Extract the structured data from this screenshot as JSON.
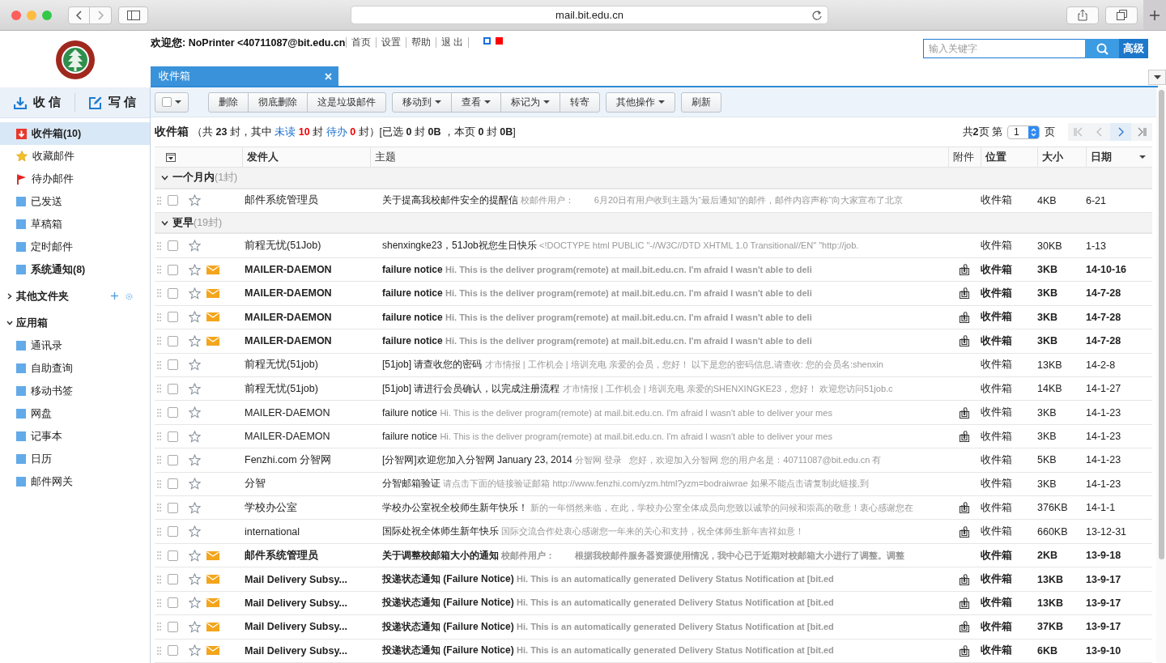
{
  "browser": {
    "url": "mail.bit.edu.cn"
  },
  "header": {
    "welcome": "欢迎您: NoPrinter <40711087@bit.edu.cn",
    "links": [
      "首页",
      "设置",
      "帮助",
      "退 出"
    ],
    "themes": [
      {
        "color": "#1a6fe0",
        "selected": true
      },
      {
        "color": "#ff0000",
        "selected": false
      }
    ],
    "search": {
      "placeholder": "输入关键字",
      "advanced": "高级"
    }
  },
  "tabs": [
    {
      "label": "收件箱",
      "selected": true
    }
  ],
  "sidebar": {
    "actions": [
      {
        "kind": "receive",
        "label": "收 信"
      },
      {
        "kind": "compose",
        "label": "写 信"
      }
    ],
    "folders": [
      {
        "kind": "inbox",
        "label": "收件箱(10)",
        "selected": true,
        "bold": true
      },
      {
        "kind": "star",
        "label": "收藏邮件",
        "selected": false,
        "bold": false
      },
      {
        "kind": "flag",
        "label": "待办邮件",
        "selected": false,
        "bold": false
      },
      {
        "kind": "folder",
        "label": "已发送",
        "selected": false,
        "bold": false
      },
      {
        "kind": "folder",
        "label": "草稿箱",
        "selected": false,
        "bold": false
      },
      {
        "kind": "folder",
        "label": "定时邮件",
        "selected": false,
        "bold": false
      },
      {
        "kind": "folder",
        "label": "系统通知(8)",
        "selected": false,
        "bold": true
      }
    ],
    "sections": [
      {
        "label": "其他文件夹",
        "expanded": false,
        "tools": true
      },
      {
        "label": "应用箱",
        "expanded": true,
        "tools": false,
        "items": [
          "通讯录",
          "自助查询",
          "移动书签",
          "网盘",
          "记事本",
          "日历",
          "邮件网关"
        ]
      }
    ]
  },
  "toolbar": {
    "groups": [
      [
        {
          "label": "删除",
          "dropdown": false
        },
        {
          "label": "彻底删除",
          "dropdown": false
        },
        {
          "label": "这是垃圾邮件",
          "dropdown": false
        }
      ],
      [
        {
          "label": "移动到",
          "dropdown": true
        },
        {
          "label": "查看",
          "dropdown": true
        },
        {
          "label": "标记为",
          "dropdown": true
        },
        {
          "label": "转寄",
          "dropdown": false
        }
      ],
      [
        {
          "label": "其他操作",
          "dropdown": true
        }
      ],
      [
        {
          "label": "刷新",
          "dropdown": false
        }
      ]
    ]
  },
  "summary": {
    "title": "收件箱",
    "parts": [
      {
        "kind": "plain",
        "text": "（共 "
      },
      {
        "kind": "bold",
        "text": "23"
      },
      {
        "kind": "plain",
        "text": " 封，其中 "
      },
      {
        "kind": "link",
        "text": "未读"
      },
      {
        "kind": "alert",
        "text": " 10"
      },
      {
        "kind": "plain",
        "text": " 封 "
      },
      {
        "kind": "link",
        "text": "待办"
      },
      {
        "kind": "alert",
        "text": " 0"
      },
      {
        "kind": "plain",
        "text": " 封）[已选 "
      },
      {
        "kind": "bold",
        "text": "0"
      },
      {
        "kind": "plain",
        "text": " 封 "
      },
      {
        "kind": "bold",
        "text": "0B"
      },
      {
        "kind": "plain",
        "text": " ，本页 "
      },
      {
        "kind": "bold",
        "text": "0"
      },
      {
        "kind": "plain",
        "text": " 封 "
      },
      {
        "kind": "bold",
        "text": "0B"
      },
      {
        "kind": "plain",
        "text": "]"
      }
    ]
  },
  "pager": {
    "total": "共**2**页 第",
    "page": "1",
    "suffix": "页",
    "buttons": [
      {
        "kind": "first",
        "disabled": true
      },
      {
        "kind": "prev",
        "disabled": true
      },
      {
        "kind": "next",
        "disabled": false
      },
      {
        "kind": "last",
        "disabled": false
      }
    ]
  },
  "table": {
    "columns": [
      "发件人",
      "主题",
      "附件",
      "位置",
      "大小",
      "日期"
    ],
    "groups": [
      {
        "label": "一个月内",
        "count": "(1封)",
        "expanded": true,
        "rows": [
          {
            "sender": "邮件系统管理员",
            "subject": "关于提高我校邮件安全的提醒信",
            "preview": "校邮件用户：        6月20日有用户收到主题为“最后通知”的邮件，邮件内容声称“向大家宣布了北京",
            "attachment": false,
            "unread": false,
            "starred": false,
            "checked": false,
            "folder": "收件箱",
            "size": "4KB",
            "date": "6-21"
          }
        ]
      },
      {
        "label": "更早",
        "count": "(19封)",
        "expanded": true,
        "rows": [
          {
            "sender": "前程无忧(51Job)",
            "subject": "shenxingke23，51Job祝您生日快乐",
            "preview": "<!DOCTYPE html PUBLIC \"-//W3C//DTD XHTML 1.0 Transitional//EN\" \"http://job.",
            "attachment": false,
            "unread": false,
            "starred": false,
            "checked": false,
            "folder": "收件箱",
            "size": "30KB",
            "date": "1-13"
          },
          {
            "sender": "MAILER-DAEMON",
            "subject": "failure notice",
            "preview": "Hi. This is the deliver program(remote) at mail.bit.edu.cn. I'm afraid I wasn't able to deli",
            "attachment": true,
            "unread": true,
            "starred": false,
            "checked": false,
            "folder": "收件箱",
            "size": "3KB",
            "date": "14-10-16"
          },
          {
            "sender": "MAILER-DAEMON",
            "subject": "failure notice",
            "preview": "Hi. This is the deliver program(remote) at mail.bit.edu.cn. I'm afraid I wasn't able to deli",
            "attachment": true,
            "unread": true,
            "starred": false,
            "checked": false,
            "folder": "收件箱",
            "size": "3KB",
            "date": "14-7-28"
          },
          {
            "sender": "MAILER-DAEMON",
            "subject": "failure notice",
            "preview": "Hi. This is the deliver program(remote) at mail.bit.edu.cn. I'm afraid I wasn't able to deli",
            "attachment": true,
            "unread": true,
            "starred": false,
            "checked": false,
            "folder": "收件箱",
            "size": "3KB",
            "date": "14-7-28"
          },
          {
            "sender": "MAILER-DAEMON",
            "subject": "failure notice",
            "preview": "Hi. This is the deliver program(remote) at mail.bit.edu.cn. I'm afraid I wasn't able to deli",
            "attachment": true,
            "unread": true,
            "starred": false,
            "checked": false,
            "folder": "收件箱",
            "size": "3KB",
            "date": "14-7-28"
          },
          {
            "sender": "前程无忧(51job)",
            "subject": "[51job] 请查收您的密码",
            "preview": "才市情报 | 工作机会 | 培训充电 亲爱的会员，您好！ 以下是您的密码信息,请查收: 您的会员名:shenxin",
            "attachment": false,
            "unread": false,
            "starred": false,
            "checked": false,
            "folder": "收件箱",
            "size": "13KB",
            "date": "14-2-8"
          },
          {
            "sender": "前程无忧(51job)",
            "subject": "[51job] 请进行会员确认，以完成注册流程",
            "preview": "才市情报 | 工作机会 | 培训充电 亲爱的SHENXINGKE23，您好！ 欢迎您访问51job.c",
            "attachment": false,
            "unread": false,
            "starred": false,
            "checked": false,
            "folder": "收件箱",
            "size": "14KB",
            "date": "14-1-27"
          },
          {
            "sender": "MAILER-DAEMON",
            "subject": "failure notice",
            "preview": "Hi. This is the deliver program(remote) at mail.bit.edu.cn. I'm afraid I wasn't able to deliver your mes",
            "attachment": true,
            "unread": false,
            "starred": false,
            "checked": false,
            "folder": "收件箱",
            "size": "3KB",
            "date": "14-1-23"
          },
          {
            "sender": "MAILER-DAEMON",
            "subject": "failure notice",
            "preview": "Hi. This is the deliver program(remote) at mail.bit.edu.cn. I'm afraid I wasn't able to deliver your mes",
            "attachment": true,
            "unread": false,
            "starred": false,
            "checked": false,
            "folder": "收件箱",
            "size": "3KB",
            "date": "14-1-23"
          },
          {
            "sender": "Fenzhi.com 分智网",
            "subject": "[分智网]欢迎您加入分智网 January 23, 2014",
            "preview": "分智网 登录   您好，欢迎加入分智网 您的用户名是：40711087@bit.edu.cn 有",
            "attachment": false,
            "unread": false,
            "starred": false,
            "checked": false,
            "folder": "收件箱",
            "size": "5KB",
            "date": "14-1-23"
          },
          {
            "sender": "分智",
            "subject": "分智邮箱验证",
            "preview": "请点击下面的链接验证邮箱 http://www.fenzhi.com/yzm.html?yzm=bodraiwrae 如果不能点击请复制此链接,到",
            "attachment": false,
            "unread": false,
            "starred": false,
            "checked": false,
            "folder": "收件箱",
            "size": "3KB",
            "date": "14-1-23"
          },
          {
            "sender": "学校办公室",
            "subject": "学校办公室祝全校师生新年快乐！",
            "preview": "新的一年悄然来临，在此，学校办公室全体成员向您致以诚挚的问候和崇高的敬意！衷心感谢您在",
            "attachment": true,
            "unread": false,
            "starred": false,
            "checked": false,
            "folder": "收件箱",
            "size": "376KB",
            "date": "14-1-1"
          },
          {
            "sender": "international",
            "subject": "国际处祝全体师生新年快乐",
            "preview": "国际交流合作处衷心感谢您一年来的关心和支持，祝全体师生新年吉祥如意！",
            "attachment": true,
            "unread": false,
            "starred": false,
            "checked": false,
            "folder": "收件箱",
            "size": "660KB",
            "date": "13-12-31"
          },
          {
            "sender": "邮件系统管理员",
            "subject": "关于调整校邮箱大小的通知",
            "preview": "校邮件用户：        根据我校邮件服务器资源使用情况，我中心已于近期对校邮箱大小进行了调整。调整",
            "attachment": false,
            "unread": true,
            "starred": false,
            "checked": false,
            "folder": "收件箱",
            "size": "2KB",
            "date": "13-9-18"
          },
          {
            "sender": "Mail Delivery Subsy...",
            "subject": "投递状态通知 (Failure Notice)",
            "preview": "Hi. This is an automatically generated Delivery Status Notification at [bit.ed",
            "attachment": true,
            "unread": true,
            "starred": false,
            "checked": false,
            "folder": "收件箱",
            "size": "13KB",
            "date": "13-9-17"
          },
          {
            "sender": "Mail Delivery Subsy...",
            "subject": "投递状态通知 (Failure Notice)",
            "preview": "Hi. This is an automatically generated Delivery Status Notification at [bit.ed",
            "attachment": true,
            "unread": true,
            "starred": false,
            "checked": false,
            "folder": "收件箱",
            "size": "13KB",
            "date": "13-9-17"
          },
          {
            "sender": "Mail Delivery Subsy...",
            "subject": "投递状态通知 (Failure Notice)",
            "preview": "Hi. This is an automatically generated Delivery Status Notification at [bit.ed",
            "attachment": true,
            "unread": true,
            "starred": false,
            "checked": false,
            "folder": "收件箱",
            "size": "37KB",
            "date": "13-9-17"
          },
          {
            "sender": "Mail Delivery Subsy...",
            "subject": "投递状态通知 (Failure Notice)",
            "preview": "Hi. This is an automatically generated Delivery Status Notification at [bit.ed",
            "attachment": true,
            "unread": true,
            "starred": false,
            "checked": false,
            "folder": "收件箱",
            "size": "6KB",
            "date": "13-9-10"
          }
        ]
      }
    ]
  }
}
